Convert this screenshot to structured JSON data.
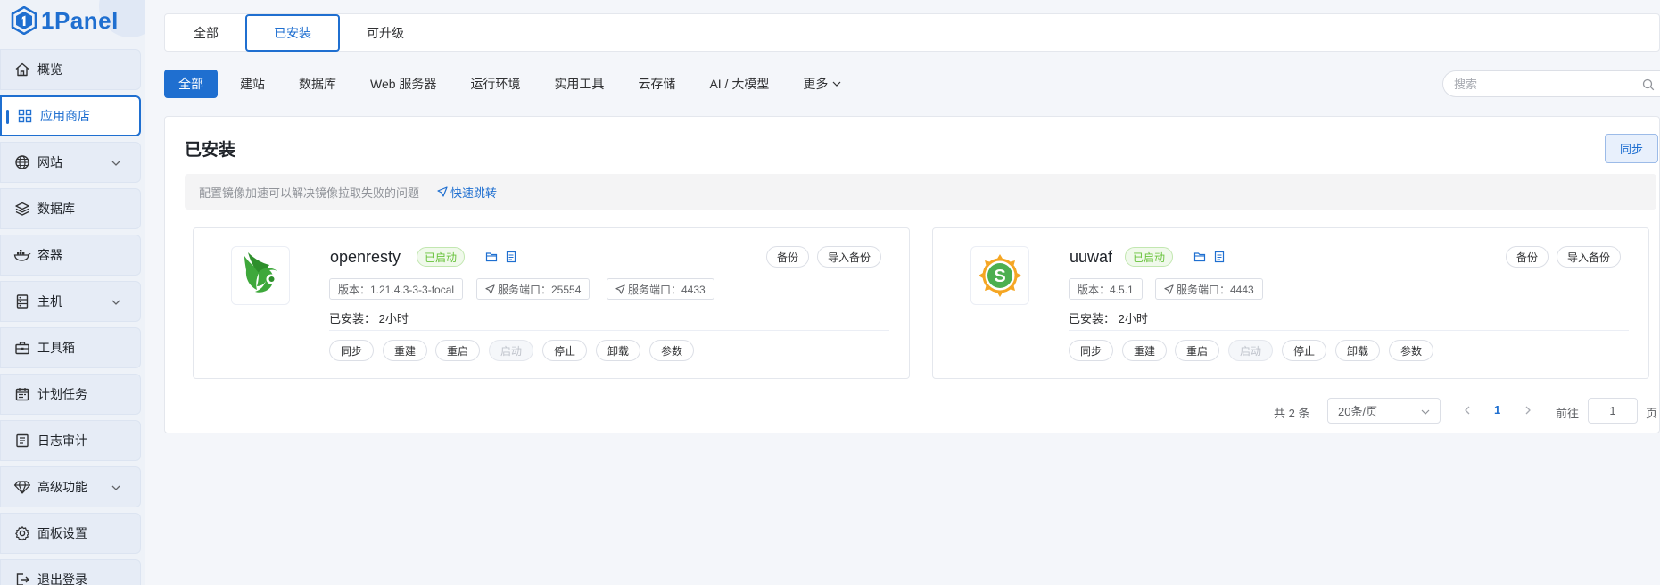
{
  "brand": {
    "name": "1Panel",
    "accent": "#1f6fd0"
  },
  "sidebar": {
    "items": [
      {
        "label": "概览",
        "icon": "home-icon"
      },
      {
        "label": "应用商店",
        "icon": "grid-icon",
        "active": true
      },
      {
        "label": "网站",
        "icon": "globe-icon",
        "expandable": true
      },
      {
        "label": "数据库",
        "icon": "layers-icon"
      },
      {
        "label": "容器",
        "icon": "docker-icon"
      },
      {
        "label": "主机",
        "icon": "server-icon",
        "expandable": true
      },
      {
        "label": "工具箱",
        "icon": "toolbox-icon"
      },
      {
        "label": "计划任务",
        "icon": "calendar-icon"
      },
      {
        "label": "日志审计",
        "icon": "log-icon"
      },
      {
        "label": "高级功能",
        "icon": "diamond-icon",
        "expandable": true
      },
      {
        "label": "面板设置",
        "icon": "gear-icon"
      },
      {
        "label": "退出登录",
        "icon": "logout-icon"
      }
    ]
  },
  "top_tabs": [
    {
      "label": "全部"
    },
    {
      "label": "已安装",
      "active": true
    },
    {
      "label": "可升级"
    }
  ],
  "filters": [
    {
      "label": "全部",
      "active": true
    },
    {
      "label": "建站"
    },
    {
      "label": "数据库"
    },
    {
      "label": "Web 服务器"
    },
    {
      "label": "运行环境"
    },
    {
      "label": "实用工具"
    },
    {
      "label": "云存储"
    },
    {
      "label": "AI / 大模型"
    },
    {
      "label": "更多"
    }
  ],
  "search": {
    "placeholder": "搜索",
    "value": ""
  },
  "panel": {
    "title": "已安装",
    "sync_label": "同步",
    "notice": "配置镜像加速可以解决镜像拉取失败的问题",
    "notice_link": "快速跳转"
  },
  "apps": [
    {
      "name": "openresty",
      "status": "已启动",
      "version_tag": "版本：1.21.4.3-3-3-focal",
      "port_tags": [
        "服务端口：25554",
        "服务端口：4433"
      ],
      "installed_label": "已安装：",
      "installed_time": "2小时",
      "backup_label": "备份",
      "import_label": "导入备份",
      "actions": [
        "同步",
        "重建",
        "重启",
        "启动",
        "停止",
        "卸载",
        "参数"
      ],
      "disabled_action": "启动"
    },
    {
      "name": "uuwaf",
      "status": "已启动",
      "version_tag": "版本：4.5.1",
      "port_tags": [
        "服务端口：4443"
      ],
      "installed_label": "已安装：",
      "installed_time": "2小时",
      "backup_label": "备份",
      "import_label": "导入备份",
      "actions": [
        "同步",
        "重建",
        "重启",
        "启动",
        "停止",
        "卸载",
        "参数"
      ],
      "disabled_action": "启动"
    }
  ],
  "pagination": {
    "total": "共 2 条",
    "page_size": "20条/页",
    "current_page": "1",
    "goto_label": "前往",
    "goto_value": "1",
    "page_word": "页"
  }
}
